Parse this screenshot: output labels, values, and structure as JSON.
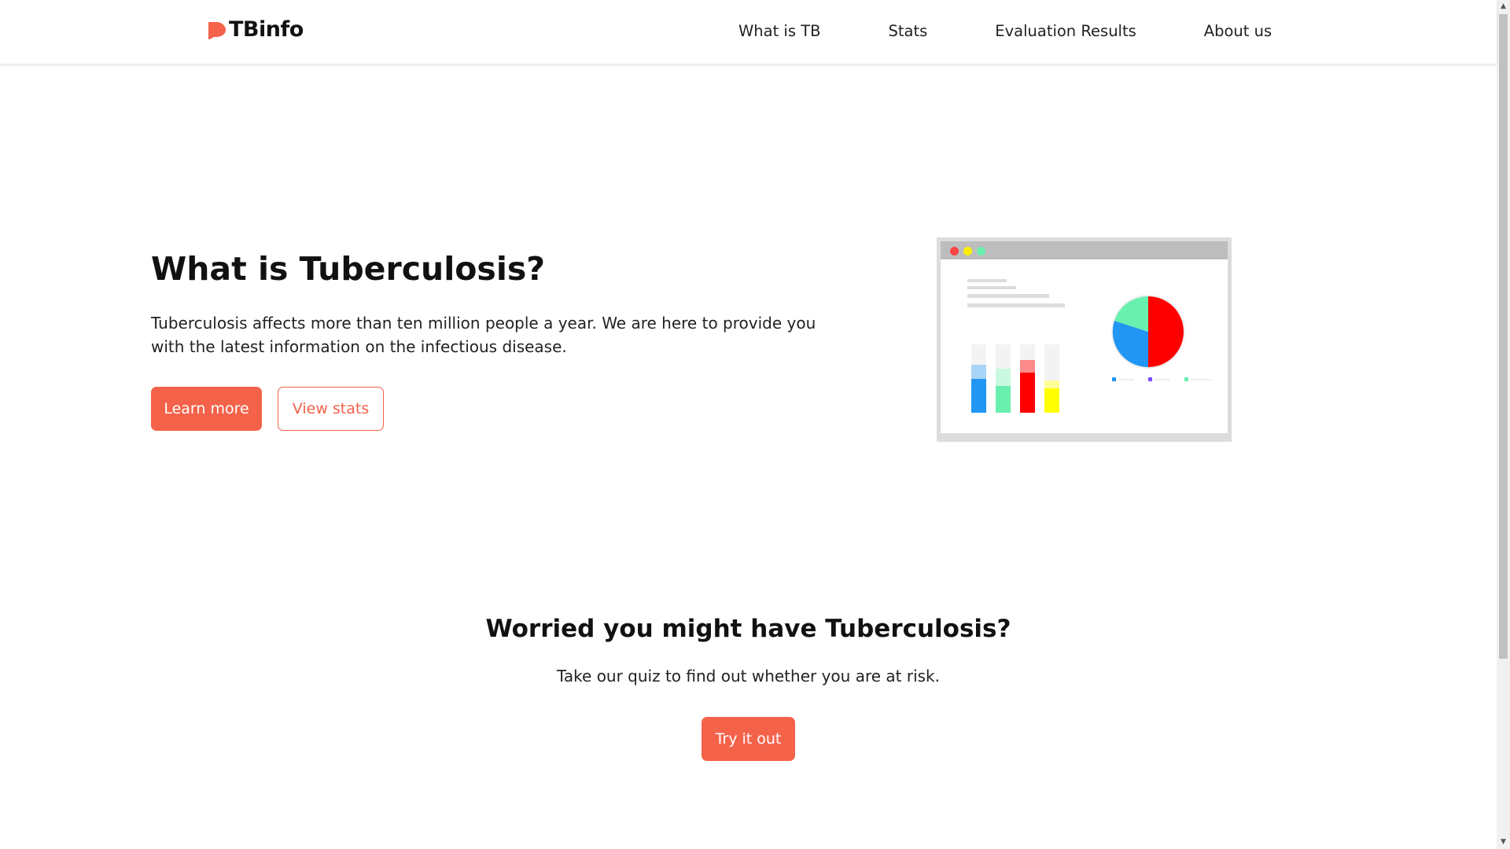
{
  "header": {
    "logo_text": "TBinfo",
    "nav": {
      "what_is_tb": "What is TB",
      "stats": "Stats",
      "evaluation_results": "Evaluation Results",
      "about_us": "About us"
    }
  },
  "hero": {
    "title": "What is Tuberculosis?",
    "text": "Tuberculosis affects more than ten million people a year. We are here to provide you with the latest information on the infectious disease.",
    "learn_more_label": "Learn more",
    "view_stats_label": "View stats"
  },
  "quiz": {
    "title": "Worried you might have Tuberculosis?",
    "text": "Take our quiz to find out whether you are at risk.",
    "button_label": "Try it out"
  },
  "colors": {
    "accent": "#f4624a",
    "bar_blue": "#2196f3",
    "bar_green": "#69f0ae",
    "bar_red": "#ff0000",
    "bar_yellow": "#ffff00",
    "pie_red": "#ff0000",
    "pie_blue": "#2196f3",
    "pie_green": "#69f0ae"
  },
  "icons": {
    "logo": "logo-mark-icon",
    "scroll_up": "scroll-up-arrow-icon",
    "scroll_down": "scroll-down-arrow-icon"
  }
}
